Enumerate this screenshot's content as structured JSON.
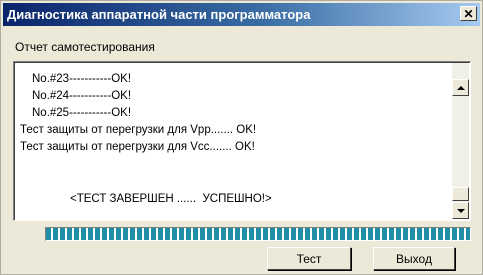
{
  "window": {
    "title": "Диагностика аппаратной части программатора",
    "close_glyph": "✕"
  },
  "group": {
    "label": "Отчет самотестирования"
  },
  "log": {
    "lines": [
      {
        "text": "No.#23-----------OK!",
        "indent": true
      },
      {
        "text": "No.#24-----------OK!",
        "indent": true
      },
      {
        "text": "No.#25-----------OK!",
        "indent": true
      },
      {
        "text": "Тест защиты от перегрузки для Vpp....... OK!",
        "indent": false
      },
      {
        "text": "Тест защиты от перегрузки для Vcc....... OK!",
        "indent": false
      }
    ],
    "final": "<ТЕСТ ЗАВЕРШЕН ......  УСПЕШНО!>",
    "scroll_position": 0.9
  },
  "progress": {
    "value": 1.0,
    "color": "#1f8fa8"
  },
  "buttons": {
    "test": "Тест",
    "exit": "Выход"
  },
  "colors": {
    "titlebar_start": "#0a246a",
    "titlebar_end": "#a6caf0",
    "face": "#ece9d8"
  }
}
